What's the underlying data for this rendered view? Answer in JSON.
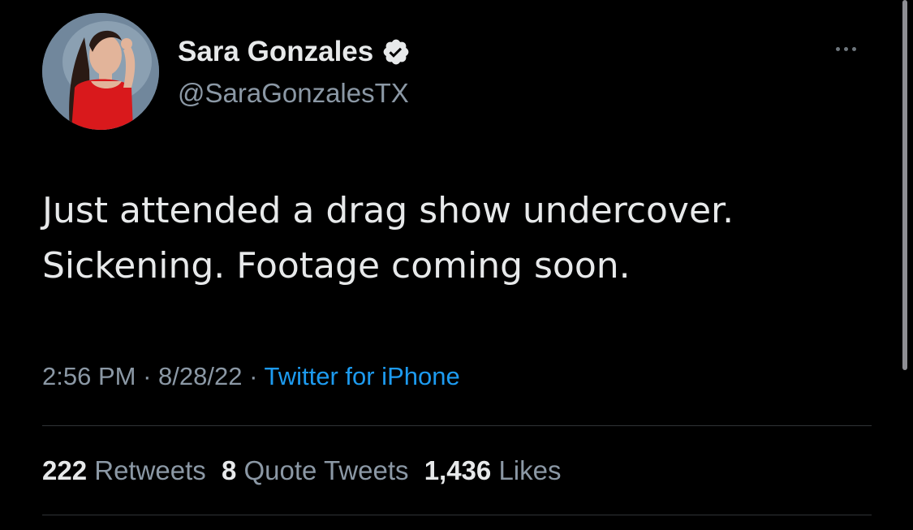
{
  "author": {
    "display_name": "Sara Gonzales",
    "handle": "@SaraGonzalesTX",
    "verified": true,
    "avatar_icon": "profile-photo"
  },
  "tweet": {
    "lines": [
      "Just attended a drag show undercover.",
      "Sickening. Footage coming soon."
    ],
    "time": "2:56 PM",
    "separator": "·",
    "date": "8/28/22",
    "source": "Twitter for iPhone"
  },
  "stats": {
    "retweets_count": "222",
    "retweets_label": "Retweets",
    "quotes_count": "8",
    "quotes_label": "Quote Tweets",
    "likes_count": "1,436",
    "likes_label": "Likes"
  },
  "colors": {
    "background": "#000000",
    "primary_text": "#e7e9ea",
    "secondary_text": "#8b98a5",
    "link": "#1d9bf0",
    "verified_badge": "#e7e9ea"
  },
  "icons": {
    "verified": "verified-badge-icon",
    "more": "more-options-icon"
  }
}
